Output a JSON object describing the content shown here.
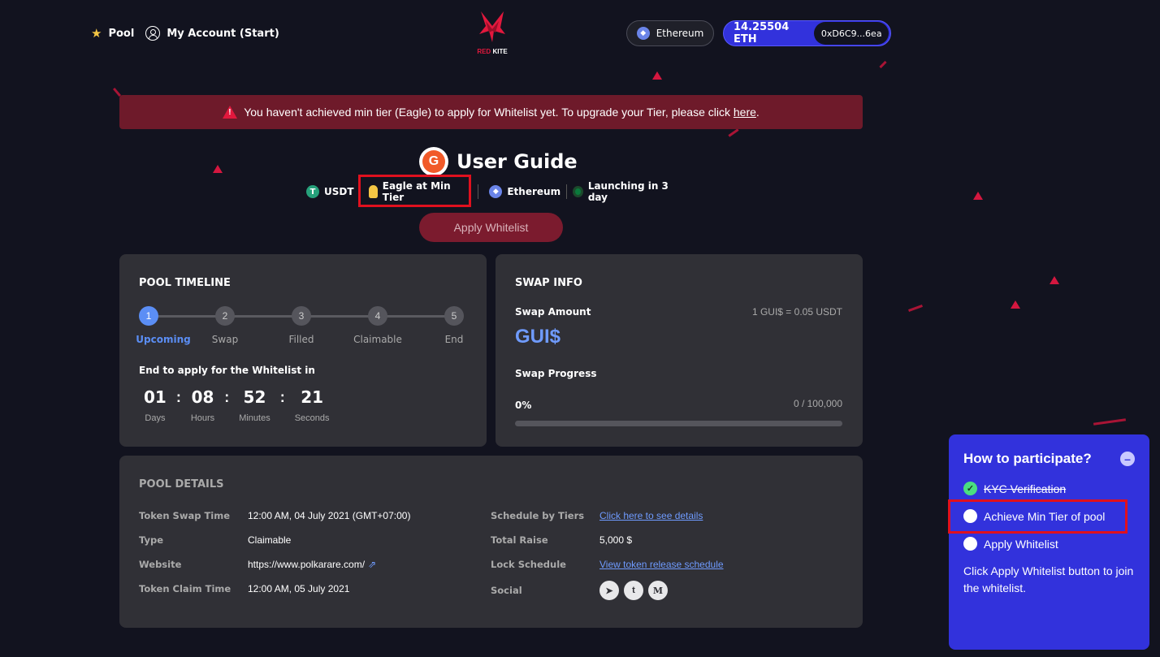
{
  "header": {
    "pool_label": "Pool",
    "account_label": "My Account (Start)",
    "logo_text_red": "RED",
    "logo_text_white": "KITE",
    "network": "Ethereum",
    "balance": "14.25504 ETH",
    "address": "0xD6C9...6ea"
  },
  "alert": {
    "text": "You haven't achieved min tier (Eagle) to apply for Whitelist yet. To upgrade your Tier, please click",
    "link": "here",
    "suffix": "."
  },
  "pool": {
    "title": "User Guide",
    "logo_glyph": "G",
    "tags": [
      "USDT",
      "Eagle at Min Tier",
      "Ethereum",
      "Launching in 3 day"
    ],
    "apply_label": "Apply Whitelist"
  },
  "timeline": {
    "title": "POOL TIMELINE",
    "steps": [
      {
        "num": "1",
        "label": "Upcoming"
      },
      {
        "num": "2",
        "label": "Swap"
      },
      {
        "num": "3",
        "label": "Filled"
      },
      {
        "num": "4",
        "label": "Claimable"
      },
      {
        "num": "5",
        "label": "End"
      }
    ],
    "countdown_label": "End to apply for the Whitelist in",
    "countdown": [
      {
        "value": "01",
        "unit": "Days"
      },
      {
        "value": "08",
        "unit": "Hours"
      },
      {
        "value": "52",
        "unit": "Minutes"
      },
      {
        "value": "21",
        "unit": "Seconds"
      }
    ]
  },
  "swap": {
    "title": "SWAP INFO",
    "amount_label": "Swap Amount",
    "rate": "1 GUI$ = 0.05  USDT",
    "token": "GUI$",
    "progress_label": "Swap Progress",
    "percent": "0%",
    "progress_fraction": 0,
    "progress_count": "0  / 100,000"
  },
  "details": {
    "title": "POOL DETAILS",
    "left": [
      {
        "label": "Token Swap Time",
        "value": "12:00 AM, 04 July 2021 (GMT+07:00)"
      },
      {
        "label": "Type",
        "value": "Claimable"
      },
      {
        "label": "Website",
        "value": "https://www.polkarare.com/"
      },
      {
        "label": "Token Claim Time",
        "value": "12:00 AM, 05 July 2021"
      }
    ],
    "right": [
      {
        "label": "Schedule by Tiers",
        "value": "Click here to see details"
      },
      {
        "label": "Total Raise",
        "value": "5,000 $"
      },
      {
        "label": "Lock Schedule",
        "value": "View token release schedule"
      },
      {
        "label": "Social",
        "value": ""
      }
    ],
    "social": [
      "telegram-icon",
      "twitter-icon",
      "medium-icon"
    ]
  },
  "participate": {
    "title": "How to participate?",
    "steps": [
      "KYC Verification",
      "Achieve Min Tier of pool",
      "Apply Whitelist"
    ],
    "description": "Click Apply Whitelist button to join the whitelist."
  },
  "colors": {
    "accent_blue": "#3232dc",
    "link_blue": "#6f9bff",
    "alert_red": "#6e1a2a",
    "highlight_red": "#e0101e"
  }
}
